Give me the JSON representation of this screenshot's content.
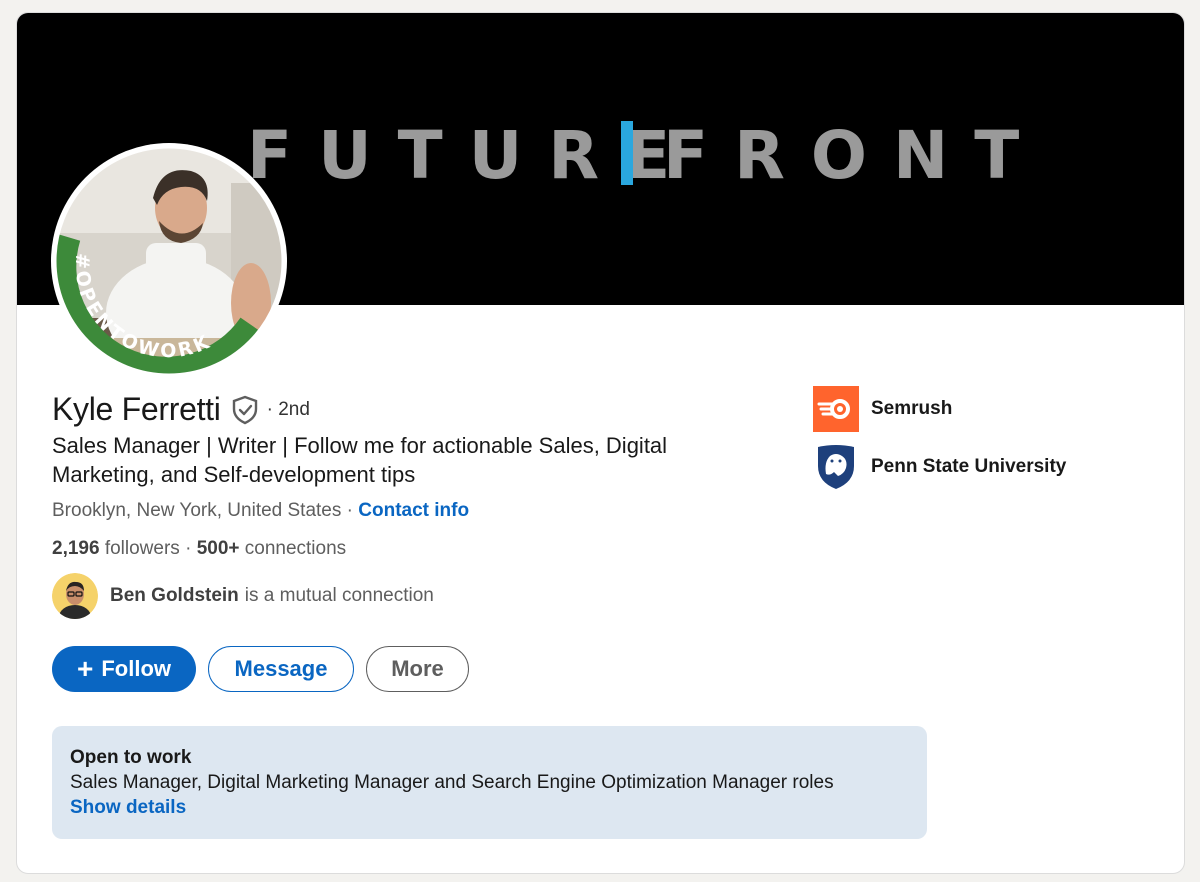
{
  "banner": {
    "word_left": "FUTURE",
    "word_right": "FRONT",
    "accent_color": "#2aa7de"
  },
  "avatar": {
    "frame_text": "#OPENTOWORK",
    "frame_color": "#3d8a3a"
  },
  "profile": {
    "name": "Kyle Ferretti",
    "degree": "· 2nd",
    "headline": "Sales Manager | Writer | Follow me for actionable Sales, Digital Marketing, and Self-development tips",
    "location": "Brooklyn, New York, United States",
    "separator": " · ",
    "contact_label": "Contact info",
    "followers_count": "2,196",
    "followers_label": " followers",
    "stats_sep": " · ",
    "connections_count": "500+",
    "connections_label": " connections",
    "mutual_name": "Ben Goldstein",
    "mutual_text": "is a mutual connection"
  },
  "actions": {
    "follow_plus": "+",
    "follow": "Follow",
    "message": "Message",
    "more": "More"
  },
  "open_to_work": {
    "title": "Open to work",
    "roles": "Sales Manager, Digital Marketing Manager and Search Engine Optimization Manager roles",
    "link": "Show details"
  },
  "side": {
    "company": "Semrush",
    "school": "Penn State University"
  },
  "colors": {
    "primary_blue": "#0a66c2",
    "semrush_orange": "#ff642d",
    "psu_navy": "#1e407c",
    "otw_bg": "#dde7f1"
  }
}
